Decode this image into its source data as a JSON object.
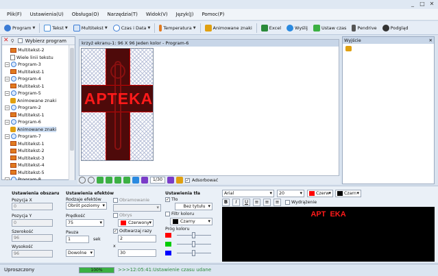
{
  "window": {
    "controls": [
      "_",
      "□",
      "✕"
    ]
  },
  "menu": [
    "Plik(F)",
    "Ustawienia(U)",
    "Obsługa(O)",
    "Narzędzia(T)",
    "Widok(V)",
    "Język(J)",
    "Pomoc(P)"
  ],
  "toolbar": [
    {
      "label": "Program",
      "icon": "gear-icon",
      "color": "#3a7bd5",
      "dropdown": true
    },
    {
      "label": "Tekst",
      "icon": "text-icon",
      "color": "#4a90d9",
      "dropdown": true
    },
    {
      "label": "Multitekst",
      "icon": "multitext-icon",
      "color": "#3a7bd5",
      "dropdown": true
    },
    {
      "label": "Czas i Data",
      "icon": "clock-icon",
      "color": "#3a7bd5",
      "dropdown": true
    },
    {
      "label": "Temperatura",
      "icon": "thermometer-icon",
      "color": "#e07a1f",
      "dropdown": true
    },
    {
      "label": "Animowane znaki",
      "icon": "animation-icon",
      "color": "#e0a010",
      "dropdown": false
    },
    {
      "label": "Excel",
      "icon": "excel-icon",
      "color": "#2a8a3a",
      "dropdown": false
    },
    {
      "label": "Wyślij",
      "icon": "send-icon",
      "color": "#2a8ae0",
      "dropdown": false
    },
    {
      "label": "Ustaw czas",
      "icon": "clock-set-icon",
      "color": "#3cb043",
      "dropdown": false
    },
    {
      "label": "Pendrive",
      "icon": "usb-icon",
      "color": "#555555",
      "dropdown": false
    },
    {
      "label": "Podgląd",
      "icon": "play-icon",
      "color": "#333333",
      "dropdown": false
    }
  ],
  "left_panel": {
    "select_program_label": "Wybierz program",
    "tree": [
      {
        "label": "Multitekst-2",
        "level": 2,
        "icon": "multitext"
      },
      {
        "label": "Wiele linii tekstu",
        "level": 2,
        "icon": "doc"
      },
      {
        "label": "Program-3",
        "level": 1,
        "icon": "globe"
      },
      {
        "label": "Multitekst-1",
        "level": 2,
        "icon": "multitext"
      },
      {
        "label": "Program-4",
        "level": 1,
        "icon": "globe"
      },
      {
        "label": "Multitekst-1",
        "level": 2,
        "icon": "multitext"
      },
      {
        "label": "Program-5",
        "level": 1,
        "icon": "globe"
      },
      {
        "label": "Animowane znaki",
        "level": 2,
        "icon": "anim"
      },
      {
        "label": "Program-2",
        "level": 1,
        "icon": "globe"
      },
      {
        "label": "Multitekst-1",
        "level": 2,
        "icon": "multitext"
      },
      {
        "label": "Program-6",
        "level": 1,
        "icon": "globe"
      },
      {
        "label": "Animowane znaki",
        "level": 2,
        "icon": "anim"
      },
      {
        "label": "Program-7",
        "level": 1,
        "icon": "globe"
      },
      {
        "label": "Multitekst-1",
        "level": 2,
        "icon": "multitext"
      },
      {
        "label": "Multitekst-2",
        "level": 2,
        "icon": "multitext"
      },
      {
        "label": "Multitekst-3",
        "level": 2,
        "icon": "multitext"
      },
      {
        "label": "Multitekst-4",
        "level": 2,
        "icon": "multitext"
      },
      {
        "label": "Multitekst-5",
        "level": 2,
        "icon": "multitext"
      },
      {
        "label": "Program-8",
        "level": 1,
        "icon": "globe"
      }
    ]
  },
  "canvas": {
    "title": "krzyż ekranu-1: 96 X 96 Jeden kolor - Program-6",
    "sign_text": "APTEKA"
  },
  "nav": {
    "page": "1/30",
    "snap_label": "Adsorbować",
    "snap_checked": true
  },
  "right_panel": {
    "title": "Wyjście"
  },
  "area": {
    "title": "Ustawienia obszaru",
    "pos_x_label": "Pozycja X",
    "pos_x": "0",
    "pos_y_label": "Pozycja Y",
    "pos_y": "0",
    "width_label": "Szerokość",
    "width": "96",
    "height_label": "Wysokość",
    "height": "96"
  },
  "effects": {
    "title": "Ustawienia efektów",
    "types_label": "Rodzaje efektów",
    "type_value": "Obrót poziomy",
    "speed_label": "Prędkość",
    "speed_value": "75",
    "pause_label": "Pauza",
    "pause_value": "1",
    "pause_unit": "sek",
    "order_value": "Dowolne",
    "border_label": "Obramowanie",
    "outline_label": "Obrys",
    "outline_color_label": "Czerwony",
    "outline_color": "#ff0000",
    "repeat_label": "Odtwarzaj razy",
    "repeat_checked": true,
    "repeat_value": "2",
    "multiply_symbol": "x",
    "repeat_total": "30"
  },
  "background": {
    "title": "Ustawienia tła",
    "bg_label": "Tło",
    "bg_checked": true,
    "bg_value": "Bez tytułu",
    "filter_label": "Filtr koloru",
    "filter_color_label": "Czarny",
    "threshold_label": "Próg koloru",
    "slider_colors": [
      "#ff0000",
      "#00cc00",
      "#0000ff"
    ]
  },
  "font": {
    "family": "Arial",
    "size": "20",
    "fg_label": "Czerw",
    "fg_color": "#ff0000",
    "bg_label": "Czarn",
    "bg_color": "#000000",
    "bold": "B",
    "italic": "I",
    "underline": "U",
    "align_label": "Wydrążenie",
    "preview_text": "APT  EKA"
  },
  "status": {
    "mode": "Uproszczony",
    "progress": "100%",
    "progress_value": 100,
    "message": ">>>12:05:41:Ustawienie czasu udane"
  }
}
